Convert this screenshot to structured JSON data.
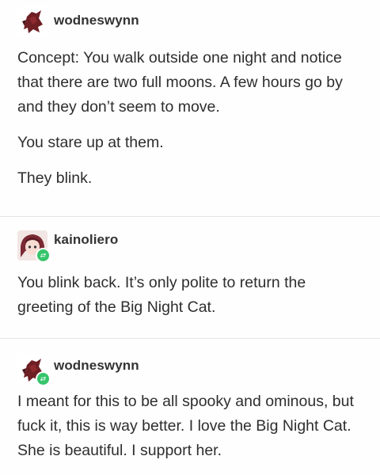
{
  "posts": [
    {
      "username": "wodneswynn",
      "avatar": "dark-red-character-avatar",
      "reblog": false,
      "paragraphs": [
        "Concept: You walk outside one night and notice that there are two full moons. A few hours go by and they don’t seem to move.",
        "You stare up at them.",
        "They blink."
      ]
    },
    {
      "username": "kainoliero",
      "avatar": "anime-character-avatar",
      "reblog": true,
      "paragraphs": [
        "You blink back. It’s only polite to return the greeting of the Big Night Cat."
      ]
    },
    {
      "username": "wodneswynn",
      "avatar": "dark-red-character-avatar",
      "reblog": true,
      "paragraphs": [
        "I meant for this to be all spooky and ominous, but fuck it, this is way better. I love the Big Night Cat. She is beautiful. I support her."
      ]
    }
  ],
  "colors": {
    "reblog_badge": "#35c46a",
    "divider": "#e4e4e4",
    "text": "#2e2e2e"
  }
}
